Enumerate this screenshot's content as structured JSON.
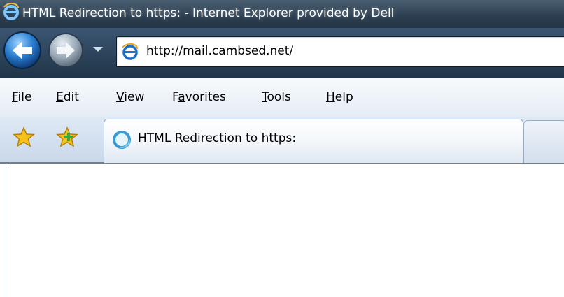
{
  "window": {
    "title": "HTML Redirection to https: - Internet Explorer provided by Dell",
    "title_icon": "ie-logo-icon"
  },
  "navigation": {
    "back_icon": "back-arrow-icon",
    "forward_icon": "forward-arrow-icon",
    "recent_pages_icon": "chevron-down-icon",
    "address": {
      "url": "http://mail.cambsed.net/",
      "page_icon": "ie-page-icon"
    }
  },
  "menubar": {
    "items": [
      {
        "label": "File",
        "accesskey": "F"
      },
      {
        "label": "Edit",
        "accesskey": "E"
      },
      {
        "label": "View",
        "accesskey": "V"
      },
      {
        "label": "Favorites",
        "accesskey": "a"
      },
      {
        "label": "Tools",
        "accesskey": "T"
      },
      {
        "label": "Help",
        "accesskey": "H"
      }
    ]
  },
  "toolbar": {
    "favorites_icon": "star-icon",
    "add_favorites_icon": "add-favorite-icon"
  },
  "tabs": [
    {
      "label": "HTML Redirection to https:",
      "icon": "loading-spinner-icon",
      "active": true
    }
  ],
  "new_tab_icon": "new-tab-icon",
  "colors": {
    "title_bar": "#2b3d4f",
    "nav_bar": "#1f3447",
    "menu_bar": "#eef3f9",
    "tab_bar": "#d3dfec",
    "content": "#ffffff"
  }
}
